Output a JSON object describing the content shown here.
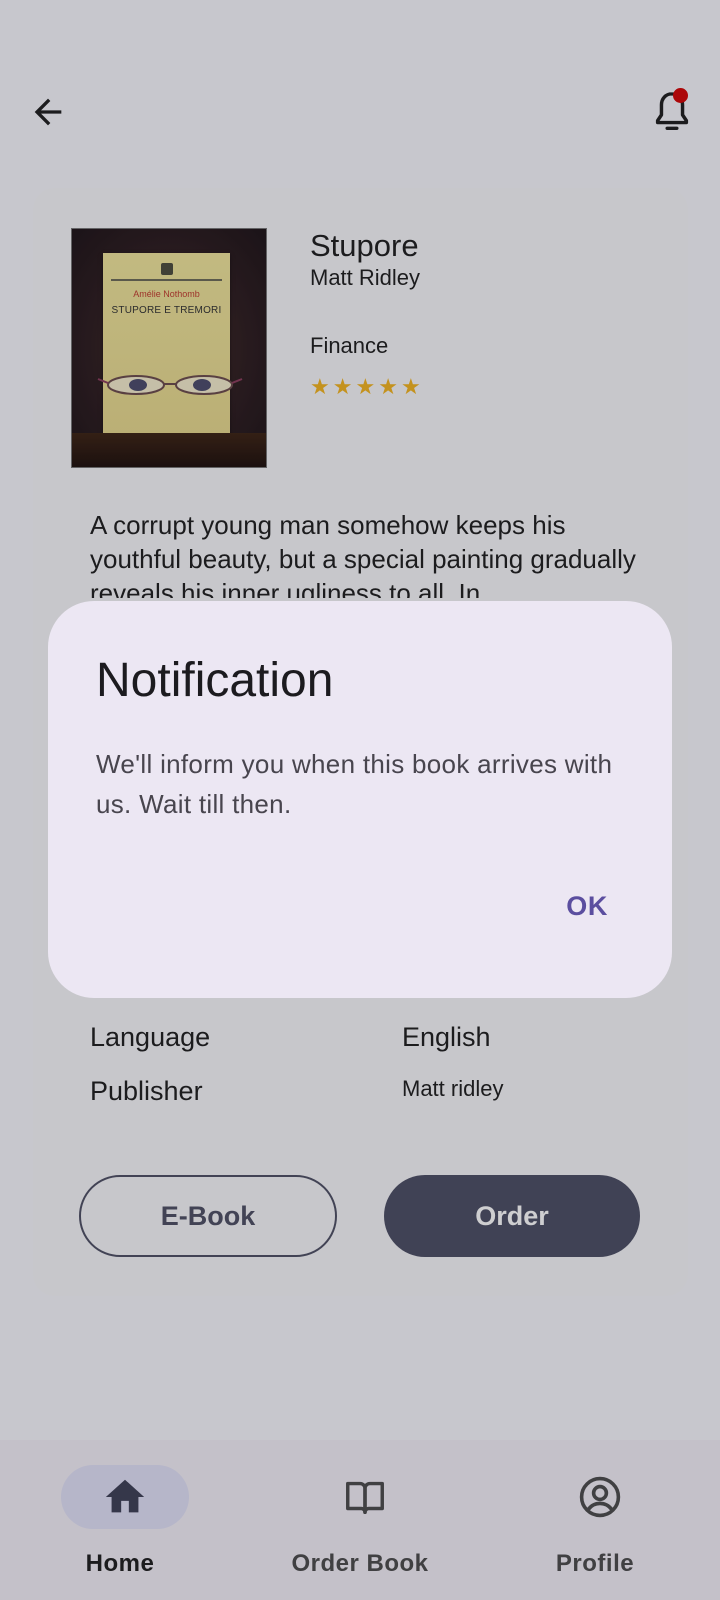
{
  "header": {
    "back_icon": "arrow-left-icon",
    "notification_icon": "bell-icon",
    "notification_badge_color": "#d40000"
  },
  "book": {
    "cover": {
      "author": "Amélie Nothomb",
      "title": "STUPORE E TREMORI"
    },
    "title": "Stupore",
    "author": "Matt Ridley",
    "category": "Finance",
    "rating": 5,
    "rating_max": 5,
    "description": "A corrupt young man somehow keeps his youthful beauty, but a special painting gradually reveals his inner ugliness to all. In"
  },
  "details": {
    "language_label": "Language",
    "language_value": "English",
    "publisher_label": "Publisher",
    "publisher_value": "Matt ridley"
  },
  "actions": {
    "ebook_label": "E-Book",
    "order_label": "Order"
  },
  "dialog": {
    "title": "Notification",
    "message": "We'll inform you when this book arrives with us. Wait till then.",
    "ok_label": "OK"
  },
  "bottom_nav": {
    "items": [
      {
        "label": "Home",
        "icon": "home-icon",
        "active": true
      },
      {
        "label": "Order Book",
        "icon": "book-open-icon",
        "active": false
      },
      {
        "label": "Profile",
        "icon": "account-circle-icon",
        "active": false
      }
    ]
  },
  "colors": {
    "primary_dark": "#4a4c62",
    "dialog_bg": "#ece7f3",
    "dialog_action": "#5b4e9f",
    "star": "#f2b21c",
    "nav_active_pill": "#e0e0f7"
  }
}
